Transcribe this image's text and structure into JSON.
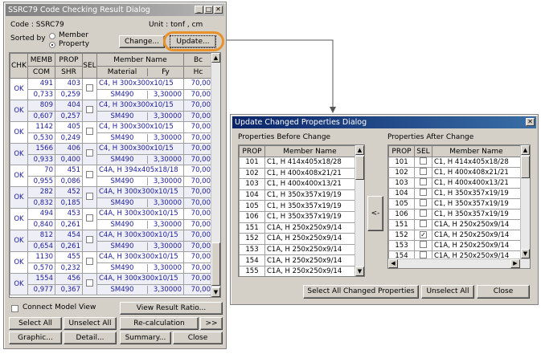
{
  "main_dialog": {
    "title": "SSRC79 Code Checking Result Dialog",
    "code_label": "Code : SSRC79",
    "unit_label": "Unit : tonf  ,  cm",
    "sorted_by_label": "Sorted by",
    "sort_options": [
      "Member",
      "Property"
    ],
    "sort_selected": "Property",
    "change_button": "Change...",
    "update_button": "Update...",
    "headers": {
      "chk": "CHK",
      "memb": "MEMB",
      "com": "COM",
      "prop": "PROP",
      "shr": "SHR",
      "sel": "SEL",
      "member_name": "Member Name",
      "material": "Material",
      "fy": "Fy",
      "bc": "Bc",
      "hc": "Hc"
    },
    "rows": [
      {
        "chk": "OK",
        "memb": "491",
        "com": "0,733",
        "prop": "403",
        "shr": "0,259",
        "name": "C4, H 300x300x10/15",
        "material": "SM490",
        "fy": "3,30000",
        "bc": "70,00",
        "hc": "70,00"
      },
      {
        "chk": "OK",
        "memb": "809",
        "com": "0,607",
        "prop": "404",
        "shr": "0,257",
        "name": "C4, H 300x300x10/15",
        "material": "SM490",
        "fy": "3,30000",
        "bc": "70,00",
        "hc": "70,00"
      },
      {
        "chk": "OK",
        "memb": "1142",
        "com": "0,530",
        "prop": "405",
        "shr": "0,249",
        "name": "C4, H 300x300x10/15",
        "material": "SM490",
        "fy": "3,30000",
        "bc": "70,00",
        "hc": "70,00"
      },
      {
        "chk": "OK",
        "memb": "1566",
        "com": "0,933",
        "prop": "406",
        "shr": "0,400",
        "name": "C4, H 300x300x10/15",
        "material": "SM490",
        "fy": "3,30000",
        "bc": "70,00",
        "hc": "70,00"
      },
      {
        "chk": "OK",
        "memb": "70",
        "com": "0,955",
        "prop": "451",
        "shr": "0,086",
        "name": "C4A, H 394x405x18/18",
        "material": "SM490",
        "fy": "3,30000",
        "bc": "70,00",
        "hc": "70,00"
      },
      {
        "chk": "OK",
        "memb": "282",
        "com": "0,832",
        "prop": "452",
        "shr": "0,185",
        "name": "C4A, H 300x300x10/15",
        "material": "SM490",
        "fy": "3,30000",
        "bc": "70,00",
        "hc": "70,00"
      },
      {
        "chk": "OK",
        "memb": "494",
        "com": "0,840",
        "prop": "453",
        "shr": "0,261",
        "name": "C4A, H 300x300x10/15",
        "material": "SM490",
        "fy": "3,30000",
        "bc": "70,00",
        "hc": "70,00"
      },
      {
        "chk": "OK",
        "memb": "812",
        "com": "0,654",
        "prop": "454",
        "shr": "0,261",
        "name": "C4A, H 300x300x10/15",
        "material": "SM490",
        "fy": "3,30000",
        "bc": "70,00",
        "hc": "70,00"
      },
      {
        "chk": "OK",
        "memb": "1130",
        "com": "0,570",
        "prop": "455",
        "shr": "0,232",
        "name": "C4A, H 300x300x10/15",
        "material": "SM490",
        "fy": "3,30000",
        "bc": "70,00",
        "hc": "70,00"
      },
      {
        "chk": "OK",
        "memb": "1554",
        "com": "0,977",
        "prop": "456",
        "shr": "0,367",
        "name": "C4A, H 300x300x10/15",
        "material": "SM490",
        "fy": "3,30000",
        "bc": "70,00",
        "hc": "70,00"
      }
    ],
    "connect_model_view": "Connect Model View",
    "view_result_ratio": "View Result Ratio...",
    "select_all": "Select All",
    "unselect_all": "Unselect All",
    "recalculation": "Re-calculation",
    "more": ">>",
    "graphic": "Graphic...",
    "detail": "Detail...",
    "summary": "Summary...",
    "close": "Close"
  },
  "update_dialog": {
    "title": "Update Changed Properties Dialog",
    "before_label": "Properties Before Change",
    "after_label": "Properties After Change",
    "prop_header": "PROP",
    "name_header": "Member Name",
    "sel_header": "SEL",
    "before_rows": [
      {
        "prop": "101",
        "name": "C1, H 414x405x18/28"
      },
      {
        "prop": "102",
        "name": "C1, H 400x408x21/21"
      },
      {
        "prop": "103",
        "name": "C1, H 400x400x13/21"
      },
      {
        "prop": "104",
        "name": "C1, H 350x357x19/19"
      },
      {
        "prop": "105",
        "name": "C1, H 350x357x19/19"
      },
      {
        "prop": "106",
        "name": "C1, H 350x357x19/19"
      },
      {
        "prop": "151",
        "name": "C1A, H 250x250x9/14"
      },
      {
        "prop": "152",
        "name": "C1A, H 250x250x9/14"
      },
      {
        "prop": "153",
        "name": "C1A, H 250x250x9/14"
      },
      {
        "prop": "154",
        "name": "C1A, H 250x250x9/14"
      },
      {
        "prop": "155",
        "name": "C1A, H 250x250x9/14"
      }
    ],
    "after_rows": [
      {
        "prop": "101",
        "sel": false,
        "name": "C1, H 414x405x18/28"
      },
      {
        "prop": "102",
        "sel": false,
        "name": "C1, H 400x408x21/21"
      },
      {
        "prop": "103",
        "sel": false,
        "name": "C1, H 400x400x13/21"
      },
      {
        "prop": "104",
        "sel": false,
        "name": "C1, H 350x357x19/19"
      },
      {
        "prop": "105",
        "sel": false,
        "name": "C1, H 350x357x19/19"
      },
      {
        "prop": "106",
        "sel": false,
        "name": "C1, H 350x357x19/19"
      },
      {
        "prop": "151",
        "sel": false,
        "name": "C1A, H 250x250x9/14"
      },
      {
        "prop": "152",
        "sel": true,
        "name": "C1A, H 250x250x9/14"
      },
      {
        "prop": "153",
        "sel": false,
        "name": "C1A, H 250x250x9/14"
      },
      {
        "prop": "154",
        "sel": false,
        "name": "C1A, H 250x250x9/14"
      }
    ],
    "copy_arrow": "<-",
    "select_all_changed": "Select All Changed Properties",
    "unselect_all": "Unselect All",
    "close": "Close"
  },
  "colors": {
    "highlight_ring": "#e8922c",
    "value_text": "#1a1a99",
    "title_active": "#0a246a"
  }
}
